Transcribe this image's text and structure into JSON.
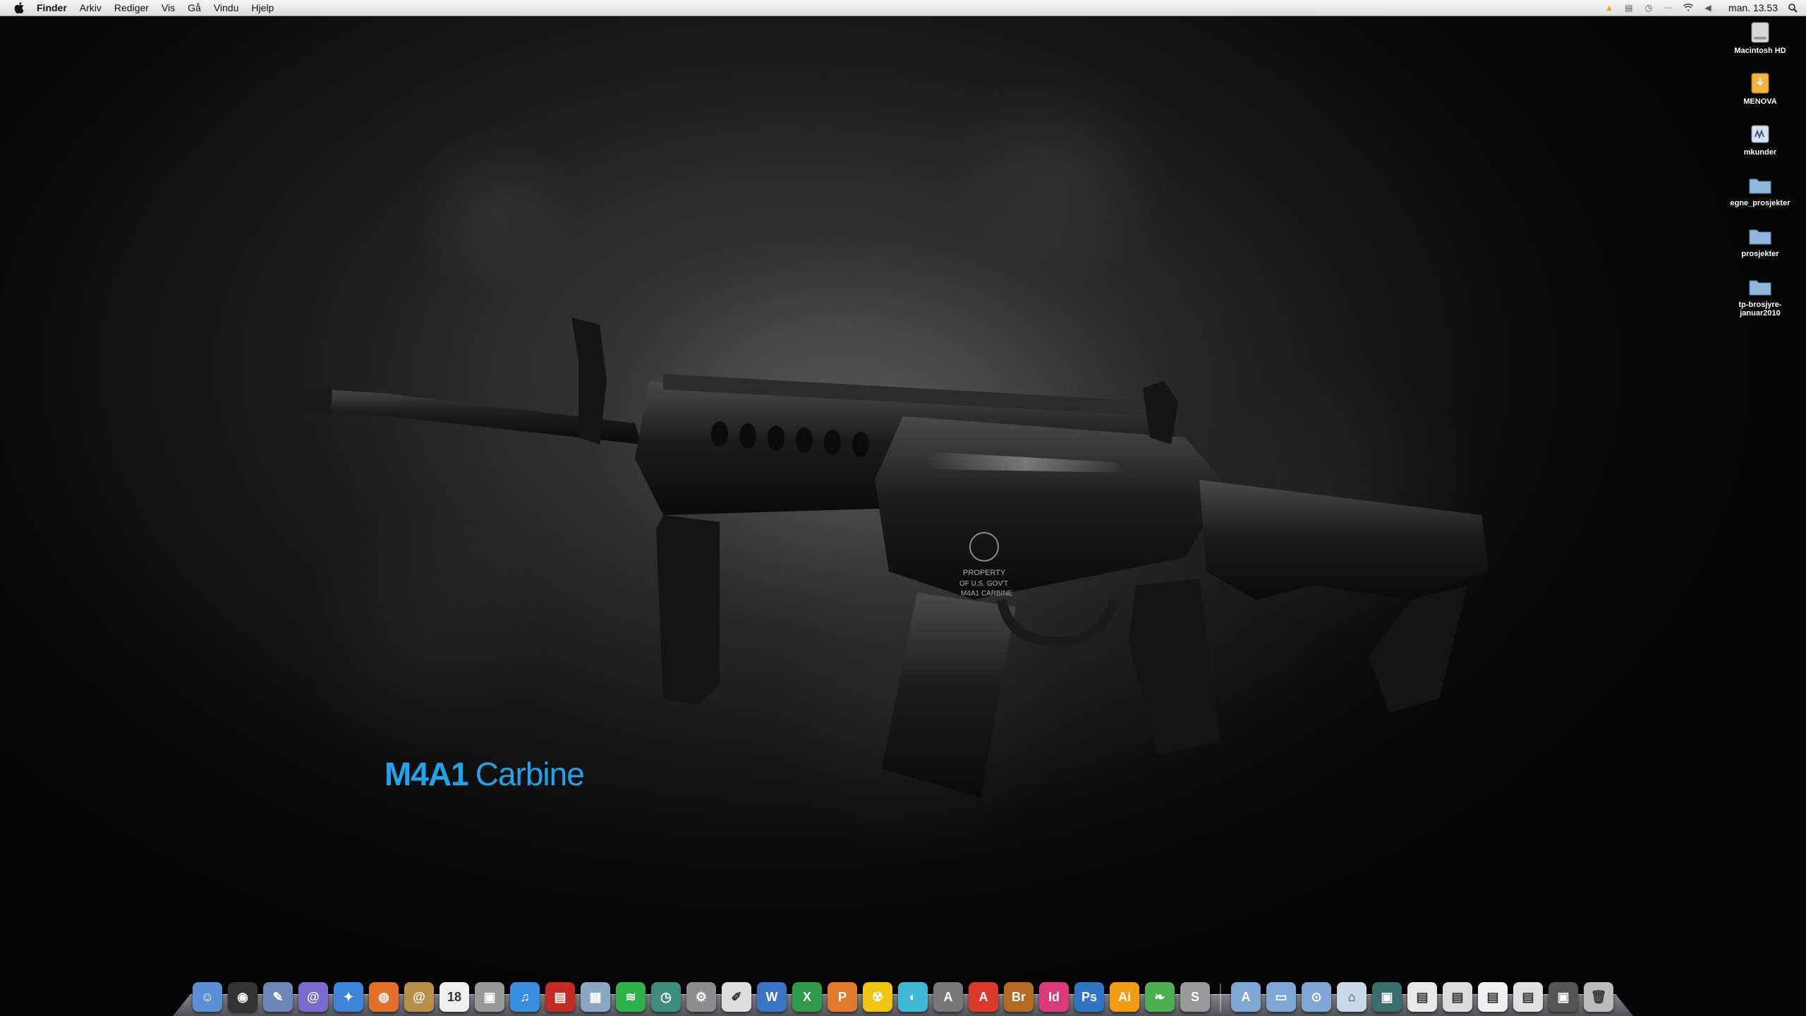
{
  "menubar": {
    "app": "Finder",
    "items": [
      "Arkiv",
      "Rediger",
      "Vis",
      "Gå",
      "Vindu",
      "Hjelp"
    ],
    "clock": "man. 13.53"
  },
  "desktop_icons": [
    {
      "label": "Macintosh HD",
      "icon": "hard-drive-icon",
      "color": "#cfcfcf"
    },
    {
      "label": "MENOVA",
      "icon": "external-drive-icon",
      "color": "#f2b43a"
    },
    {
      "label": "mkunder",
      "icon": "network-drive-icon",
      "color": "#c9d6e8"
    },
    {
      "label": "egne_prosjekter",
      "icon": "folder-icon",
      "color": "#8fb6dd"
    },
    {
      "label": "prosjekter",
      "icon": "folder-icon",
      "color": "#8fb6dd"
    },
    {
      "label": "tp-brosjyre-januar2010",
      "icon": "folder-icon",
      "color": "#8fb6dd"
    }
  ],
  "wallpaper": {
    "title_bold": "M4A1",
    "title_light": "Carbine",
    "title_color": "#1ea4e8",
    "engraving": [
      "PROPERTY",
      "OF U.S. GOV'T",
      "M4A1 CARBINE"
    ]
  },
  "dock": {
    "apps": [
      {
        "name": "finder-icon",
        "color": "#5a8fd6",
        "glyph": "☺"
      },
      {
        "name": "dashboard-icon",
        "color": "#333333",
        "glyph": "◉"
      },
      {
        "name": "preview-icon",
        "color": "#6f87b8",
        "glyph": "✎"
      },
      {
        "name": "mail-icon",
        "color": "#7b6bd0",
        "glyph": "@"
      },
      {
        "name": "safari-icon",
        "color": "#3d85d8",
        "glyph": "✦"
      },
      {
        "name": "firefox-icon",
        "color": "#e2702a",
        "glyph": "◍"
      },
      {
        "name": "address-book-icon",
        "color": "#b98f4a",
        "glyph": "@"
      },
      {
        "name": "ical-icon",
        "color": "#eeeeee",
        "glyph": "18"
      },
      {
        "name": "photo-app-icon",
        "color": "#999999",
        "glyph": "▣"
      },
      {
        "name": "itunes-icon",
        "color": "#3a8ee0",
        "glyph": "♫"
      },
      {
        "name": "photo-booth-icon",
        "color": "#c22a22",
        "glyph": "▤"
      },
      {
        "name": "iphoto-icon",
        "color": "#8aa7c8",
        "glyph": "▦"
      },
      {
        "name": "spotify-icon",
        "color": "#2fb24c",
        "glyph": "≋"
      },
      {
        "name": "time-machine-icon",
        "color": "#3e8c7a",
        "glyph": "◷"
      },
      {
        "name": "system-preferences-icon",
        "color": "#8c8c8c",
        "glyph": "⚙"
      },
      {
        "name": "textedit-icon",
        "color": "#dddddd",
        "glyph": "✐"
      },
      {
        "name": "word-icon",
        "color": "#3b74c6",
        "glyph": "W"
      },
      {
        "name": "excel-icon",
        "color": "#2e9b4a",
        "glyph": "X"
      },
      {
        "name": "powerpoint-icon",
        "color": "#e27a2e",
        "glyph": "P"
      },
      {
        "name": "burn-icon",
        "color": "#f1c40f",
        "glyph": "☢"
      },
      {
        "name": "chat-icon",
        "color": "#3fb8d8",
        "glyph": "◐"
      },
      {
        "name": "acrobat-icon",
        "color": "#777777",
        "glyph": "A"
      },
      {
        "name": "acrobat-reader-icon",
        "color": "#d93a2a",
        "glyph": "A"
      },
      {
        "name": "bridge-icon",
        "color": "#b56a22",
        "glyph": "Br"
      },
      {
        "name": "indesign-icon",
        "color": "#d83a7a",
        "glyph": "Id"
      },
      {
        "name": "photoshop-icon",
        "color": "#2f77c6",
        "glyph": "Ps"
      },
      {
        "name": "illustrator-icon",
        "color": "#f39c12",
        "glyph": "Ai"
      },
      {
        "name": "leaf-icon",
        "color": "#4caf50",
        "glyph": "❧"
      },
      {
        "name": "silverlock-icon",
        "color": "#9a9a9a",
        "glyph": "S"
      }
    ],
    "stacks": [
      {
        "name": "applications-stack-icon",
        "color": "#7ea7d6",
        "glyph": "A"
      },
      {
        "name": "documents-stack-icon",
        "color": "#7ea7d6",
        "glyph": "▭"
      },
      {
        "name": "downloads-stack-icon",
        "color": "#7ea7d6",
        "glyph": "⊙"
      },
      {
        "name": "network-stack-icon",
        "color": "#c9d6e8",
        "glyph": "⌂"
      },
      {
        "name": "screen-thumb-icon",
        "color": "#3a6e6e",
        "glyph": "▣"
      },
      {
        "name": "doc-thumb-icon",
        "color": "#e8e8e8",
        "glyph": "▤"
      },
      {
        "name": "doc-thumb-icon",
        "color": "#dcdcdc",
        "glyph": "▤"
      },
      {
        "name": "doc-thumb-icon",
        "color": "#f0f0f0",
        "glyph": "▤"
      },
      {
        "name": "doc-thumb-icon",
        "color": "#e0e0e0",
        "glyph": "▤"
      },
      {
        "name": "screen-thumb-icon",
        "color": "#555555",
        "glyph": "▣"
      },
      {
        "name": "trash-icon",
        "color": "#bbbbbb",
        "glyph": "🗑"
      }
    ]
  }
}
